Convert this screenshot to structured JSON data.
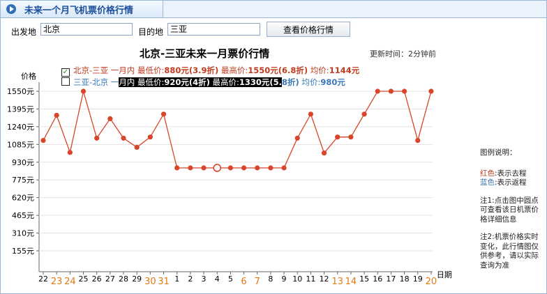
{
  "header": {
    "title": "未来一个月飞机票价格行情"
  },
  "search": {
    "from_label": "出发地",
    "from_value": "北京",
    "to_label": "目的地",
    "to_value": "三亚",
    "button_label": "查看价格行情"
  },
  "chart_data": {
    "type": "line",
    "title": "北京-三亚未来一月票价行情",
    "update_time": "更新时间：2分钟前",
    "ylabel": "价格",
    "xlabel": "日期",
    "ylim": [
      0,
      1705
    ],
    "yticks": [
      "1550元",
      "1395元",
      "1240元",
      "1085元",
      "930元",
      "775元",
      "620元",
      "465元",
      "310元",
      "155元"
    ],
    "ytick_values": [
      1550,
      1395,
      1240,
      1085,
      930,
      775,
      620,
      465,
      310,
      155
    ],
    "categories": [
      "22",
      "23",
      "24",
      "25",
      "26",
      "27",
      "28",
      "29",
      "30",
      "31",
      "1",
      "2",
      "3",
      "4",
      "5",
      "6",
      "7",
      "8",
      "9",
      "10",
      "11",
      "12",
      "13",
      "14",
      "15",
      "16",
      "17",
      "18",
      "19",
      "20"
    ],
    "highlight_categories": [
      "23",
      "24",
      "30",
      "31",
      "6",
      "7",
      "13",
      "14",
      "20"
    ],
    "series": [
      {
        "name": "北京-三亚 一月内",
        "color": "#d8452a",
        "values": [
          1120,
          1340,
          1015,
          1550,
          1140,
          1310,
          1140,
          1060,
          1150,
          1350,
          880,
          880,
          880,
          880,
          880,
          880,
          880,
          880,
          880,
          1140,
          1350,
          1010,
          1150,
          1150,
          1350,
          1550,
          1550,
          1550,
          1120,
          1550
        ]
      }
    ],
    "selected_point_index": 13,
    "legend": [
      {
        "checked": true,
        "mark": "✓",
        "route": "北京-三亚 一月内",
        "min_label": "最低价:",
        "min_value": "880元(3.9折)",
        "max_label": "最高价:",
        "max_value": "1550元(6.8折)",
        "avg_label": "均价:",
        "avg_value": "1144元"
      },
      {
        "checked": false,
        "mark": "",
        "route": "三亚-北京 一",
        "route2": "月内",
        "min_label": "最低价:",
        "min_value": "920元(4折)",
        "max_label": "最高价:",
        "max_value": "1330元(5.",
        "max_value2": "8折)",
        "avg_label": "均价:",
        "avg_value": "980元"
      }
    ]
  },
  "side_note": {
    "legend_title": "图例说明：",
    "red_word": "红色",
    "red_text": ":表示去程",
    "blue_word": "蓝色",
    "blue_text": ":表示返程",
    "note1": "注1:点击图中圆点可查看该日机票价格详细信息",
    "note2": "注2:机票价格实时变化，此行情图仅供参考，请以实际查询为准"
  },
  "colors": {
    "accent": "#1d4f9a",
    "go": "#c23b1f",
    "return": "#3b78b8",
    "highlight_date": "#e07a10"
  }
}
